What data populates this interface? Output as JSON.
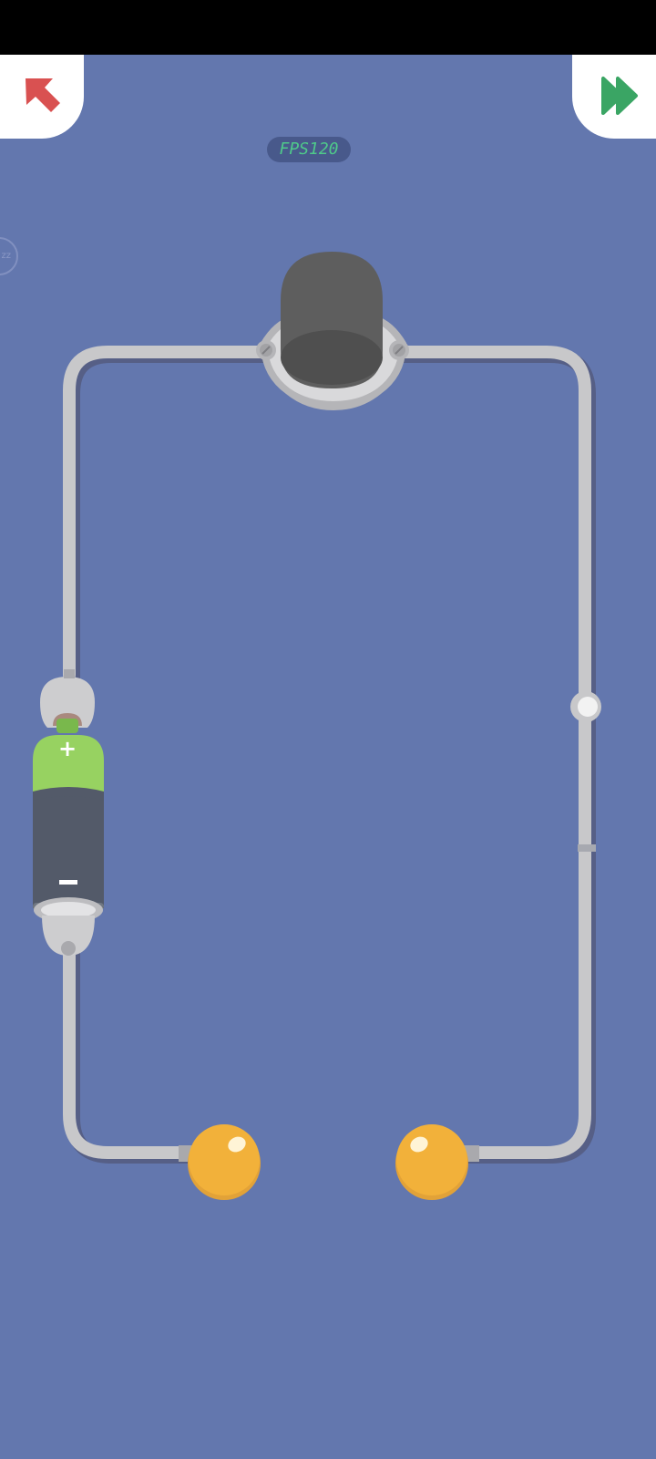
{
  "hud": {
    "fps_label": "FPS120",
    "side_indicator_text": "zz"
  },
  "buttons": {
    "back_icon": "arrow-up-left-icon",
    "skip_icon": "fast-forward-icon"
  },
  "circuit": {
    "components": [
      "battery",
      "dark-cup",
      "switch",
      "left-terminal",
      "right-terminal"
    ],
    "battery_plus": "+",
    "battery_minus": "—"
  },
  "colors": {
    "background": "#6377ae",
    "wire": "#c8c8ca",
    "wire_shadow": "#5a6272",
    "back_arrow": "#d95151",
    "skip_arrow": "#3aa564",
    "battery_positive": "#97d261",
    "battery_body": "#535a69",
    "terminal": "#f2b13a",
    "cup": "#5e5e5e",
    "fps_text": "#4fc98a"
  }
}
